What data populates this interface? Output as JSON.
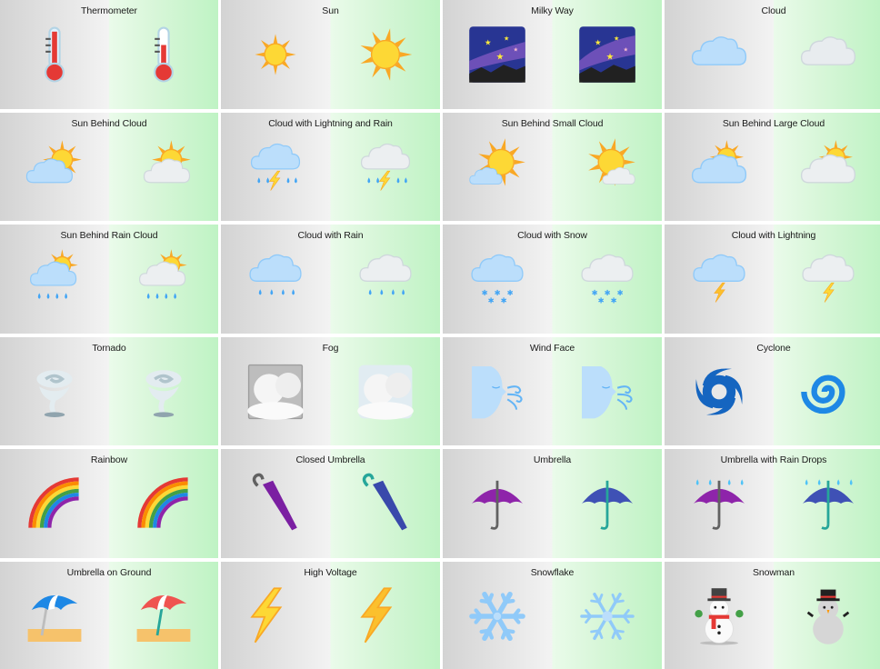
{
  "panels": [
    {
      "label": "Thermometer",
      "left_icon": "thermometer-icon",
      "right_icon": "thermometer-icon"
    },
    {
      "label": "Sun",
      "left_icon": "sun-icon",
      "right_icon": "sun-icon"
    },
    {
      "label": "Milky Way",
      "left_icon": "milky-way-icon",
      "right_icon": "milky-way-icon"
    },
    {
      "label": "Cloud",
      "left_icon": "cloud-icon",
      "right_icon": "cloud-icon"
    },
    {
      "label": "Sun Behind Cloud",
      "left_icon": "sun-behind-cloud-icon",
      "right_icon": "sun-behind-cloud-icon"
    },
    {
      "label": "Cloud with Lightning and Rain",
      "left_icon": "cloud-lightning-rain-icon",
      "right_icon": "cloud-lightning-rain-icon"
    },
    {
      "label": "Sun Behind Small Cloud",
      "left_icon": "sun-behind-small-cloud-icon",
      "right_icon": "sun-behind-small-cloud-icon"
    },
    {
      "label": "Sun Behind Large Cloud",
      "left_icon": "sun-behind-large-cloud-icon",
      "right_icon": "sun-behind-large-cloud-icon"
    },
    {
      "label": "Sun Behind Rain Cloud",
      "left_icon": "sun-behind-rain-cloud-icon",
      "right_icon": "sun-behind-rain-cloud-icon"
    },
    {
      "label": "Cloud with Rain",
      "left_icon": "cloud-rain-icon",
      "right_icon": "cloud-rain-icon"
    },
    {
      "label": "Cloud with Snow",
      "left_icon": "cloud-snow-icon",
      "right_icon": "cloud-snow-icon"
    },
    {
      "label": "Cloud with Lightning",
      "left_icon": "cloud-lightning-icon",
      "right_icon": "cloud-lightning-icon"
    },
    {
      "label": "Tornado",
      "left_icon": "tornado-icon",
      "right_icon": "tornado-icon"
    },
    {
      "label": "Fog",
      "left_icon": "fog-icon",
      "right_icon": "fog-icon"
    },
    {
      "label": "Wind Face",
      "left_icon": "wind-face-icon",
      "right_icon": "wind-face-icon"
    },
    {
      "label": "Cyclone",
      "left_icon": "cyclone-icon",
      "right_icon": "cyclone-icon"
    },
    {
      "label": "Rainbow",
      "left_icon": "rainbow-icon",
      "right_icon": "rainbow-icon"
    },
    {
      "label": "Closed Umbrella",
      "left_icon": "closed-umbrella-icon",
      "right_icon": "closed-umbrella-icon"
    },
    {
      "label": "Umbrella",
      "left_icon": "umbrella-icon",
      "right_icon": "umbrella-icon"
    },
    {
      "label": "Umbrella with Rain Drops",
      "left_icon": "umbrella-rain-drops-icon",
      "right_icon": "umbrella-rain-drops-icon"
    },
    {
      "label": "Umbrella on Ground",
      "left_icon": "umbrella-on-ground-icon",
      "right_icon": "umbrella-on-ground-icon"
    },
    {
      "label": "High Voltage",
      "left_icon": "high-voltage-icon",
      "right_icon": "high-voltage-icon"
    },
    {
      "label": "Snowflake",
      "left_icon": "snowflake-icon",
      "right_icon": "snowflake-icon"
    },
    {
      "label": "Snowman",
      "left_icon": "snowman-icon",
      "right_icon": "snowman-icon"
    }
  ],
  "colors": {
    "left_bg_start": "#d3d3d3",
    "left_bg_end": "#f3f3f3",
    "right_bg_start": "#eafbea",
    "right_bg_end": "#bff3c4"
  }
}
